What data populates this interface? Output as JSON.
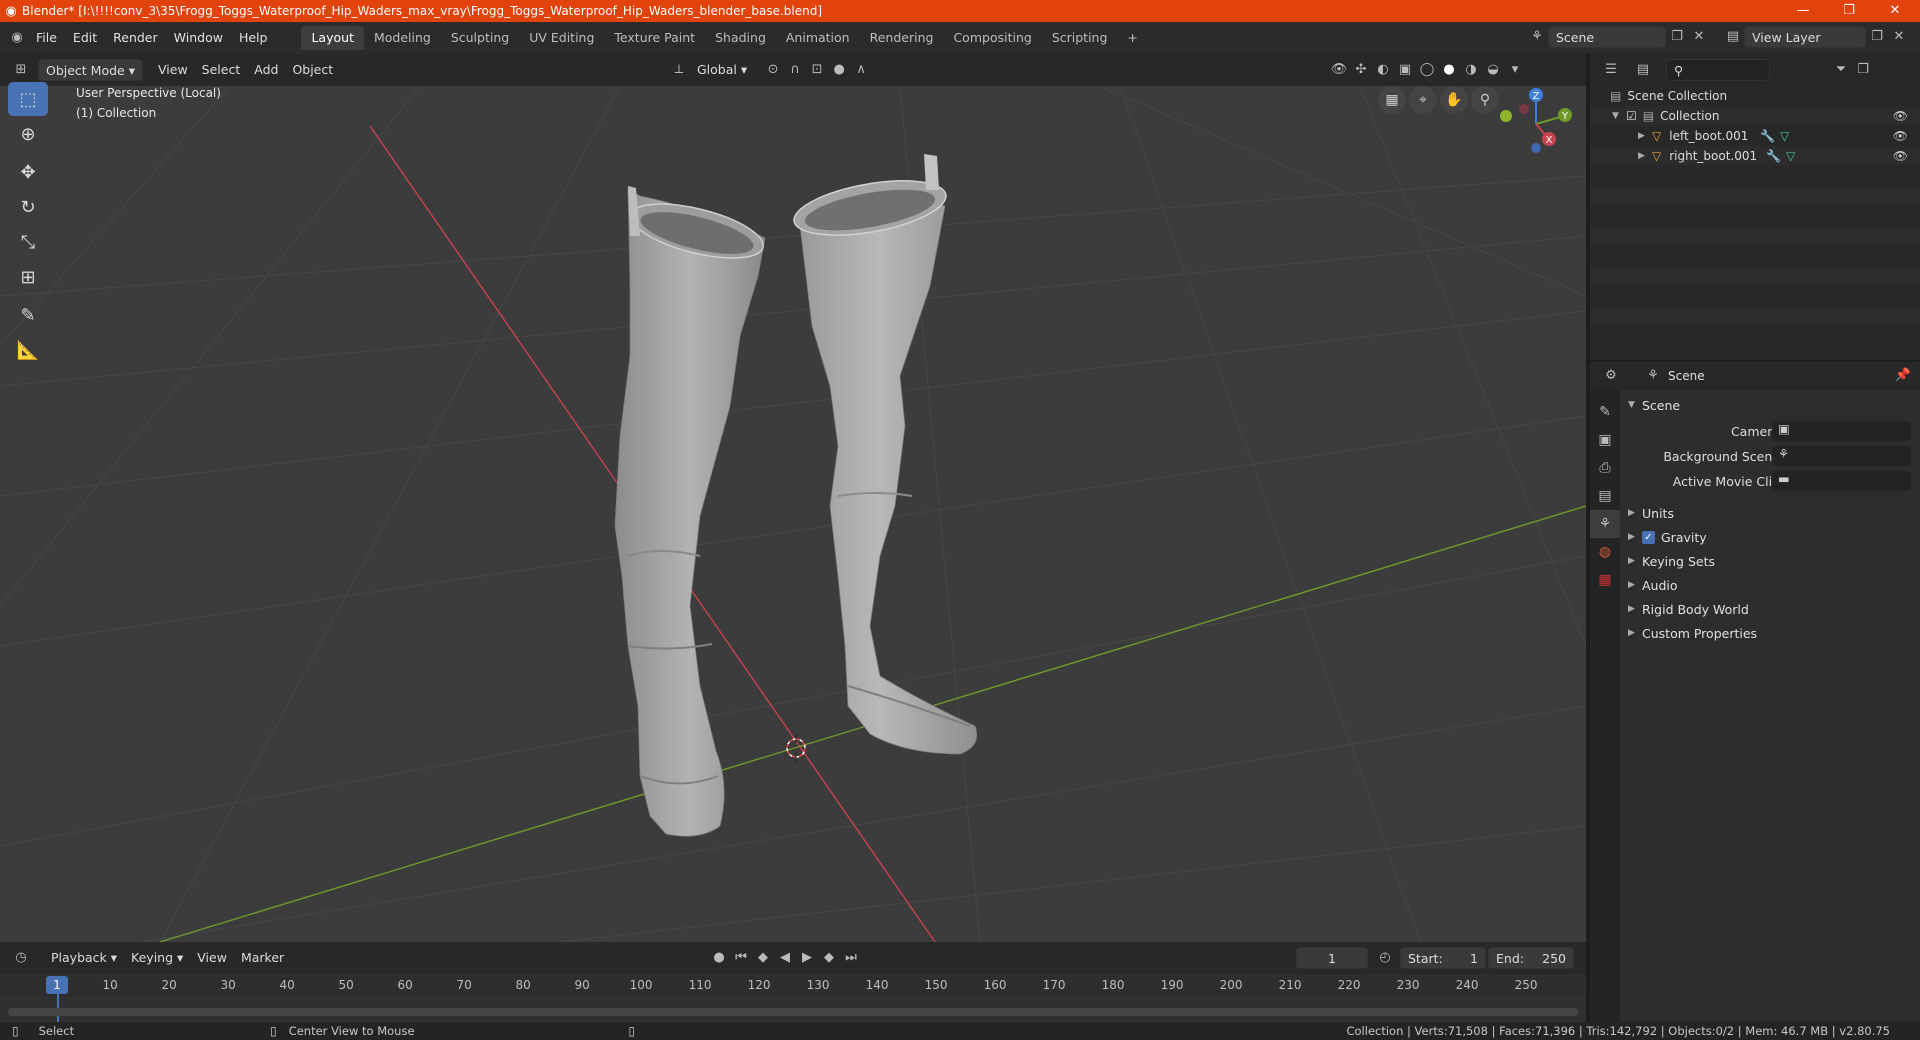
{
  "titlebar": {
    "title": "Blender* [I:\\!!!!conv_3\\35\\Frogg_Toggs_Waterproof_Hip_Waders_max_vray\\Frogg_Toggs_Waterproof_Hip_Waders_blender_base.blend]",
    "minimize": "—",
    "restore": "❐",
    "close": "✕"
  },
  "menubar": {
    "menus": [
      "File",
      "Edit",
      "Render",
      "Window",
      "Help"
    ],
    "workspaces": [
      "Layout",
      "Modeling",
      "Sculpting",
      "UV Editing",
      "Texture Paint",
      "Shading",
      "Animation",
      "Rendering",
      "Compositing",
      "Scripting"
    ],
    "active_workspace": "Layout",
    "add_tab": "+",
    "scene_label": "Scene",
    "view_layer_label": "View Layer"
  },
  "viewport_header": {
    "mode": "Object Mode",
    "menus": [
      "View",
      "Select",
      "Add",
      "Object"
    ],
    "transform_orientation": "Global"
  },
  "viewport": {
    "overlay_line1": "User Perspective (Local)",
    "overlay_line2": "(1) Collection",
    "gizmo_axes": [
      "Z",
      "Y",
      "X"
    ],
    "colors": {
      "x_axis": "#c7424f",
      "y_axis": "#6f9a2a",
      "z_axis": "#3e7fe0",
      "background": "#3c3c3c",
      "mesh": "#a9a9a9"
    }
  },
  "toolbar": {
    "tools": [
      "select-box",
      "cursor",
      "move",
      "rotate",
      "scale",
      "transform",
      "annotate",
      "measure"
    ],
    "active": "select-box"
  },
  "timeline_header": {
    "menus": [
      "Playback",
      "Keying",
      "View",
      "Marker"
    ],
    "current_frame": "1",
    "start_label": "Start:",
    "start_value": "1",
    "end_label": "End:",
    "end_value": "250"
  },
  "timeline": {
    "ticks": [
      "10",
      "20",
      "30",
      "40",
      "50",
      "60",
      "70",
      "80",
      "90",
      "100",
      "110",
      "120",
      "130",
      "140",
      "150",
      "160",
      "170",
      "180",
      "190",
      "200",
      "210",
      "220",
      "230",
      "240",
      "250"
    ],
    "current": "1"
  },
  "statusbar": {
    "left_action": "Select",
    "middle_action": "Center View to Mouse",
    "stats": "Collection | Verts:71,508 | Faces:71,396 | Tris:142,792 | Objects:0/2 | Mem: 46.7 MB | v2.80.75"
  },
  "outliner": {
    "root": "Scene Collection",
    "collection": "Collection",
    "objects": [
      "left_boot.001",
      "right_boot.001"
    ]
  },
  "properties": {
    "context": "Scene",
    "section": "Scene",
    "fields": [
      "Camera",
      "Background Scene",
      "Active Movie Clip"
    ],
    "panels": [
      "Units",
      "Gravity",
      "Keying Sets",
      "Audio",
      "Rigid Body World",
      "Custom Properties"
    ],
    "gravity_enabled": true
  }
}
